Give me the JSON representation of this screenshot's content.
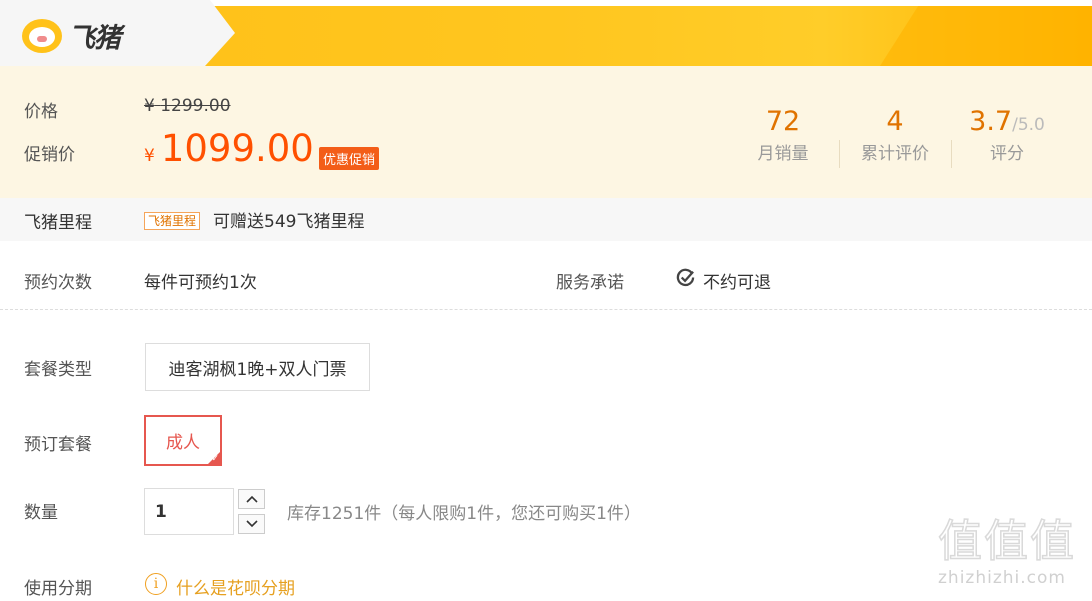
{
  "header": {
    "logo_text": "飞猪",
    "brand_color": "#ffc21a"
  },
  "price": {
    "label_price": "价格",
    "label_sale": "促销价",
    "original_currency": "¥",
    "original_amount": "1299.00",
    "sale_currency": "¥",
    "sale_amount": "1099.00",
    "promo_tag": "优惠促销",
    "accent_color": "#ff5000"
  },
  "stats": [
    {
      "value": "72",
      "max": "",
      "label": "月销量"
    },
    {
      "value": "4",
      "max": "",
      "label": "累计评价"
    },
    {
      "value": "3.7",
      "max": "/5.0",
      "label": "评分"
    }
  ],
  "mileage": {
    "label": "飞猪里程",
    "tag": "飞猪里程",
    "text": "可赠送549飞猪里程"
  },
  "booking": {
    "limit_label": "预约次数",
    "limit_value": "每件可预约1次",
    "service_label": "服务承诺",
    "service_value": "不约可退"
  },
  "package_type": {
    "label": "套餐类型",
    "option": "迪客湖枫1晚+双人门票"
  },
  "book_package": {
    "label": "预订套餐",
    "option": "成人"
  },
  "quantity": {
    "label": "数量",
    "value": "1",
    "stock_text": "库存1251件（每人限购1件，您还可购买1件）"
  },
  "installment": {
    "label": "使用分期",
    "link": "什么是花呗分期"
  },
  "watermark": {
    "big": "值值值",
    "small": "zhizhizhi.com"
  }
}
